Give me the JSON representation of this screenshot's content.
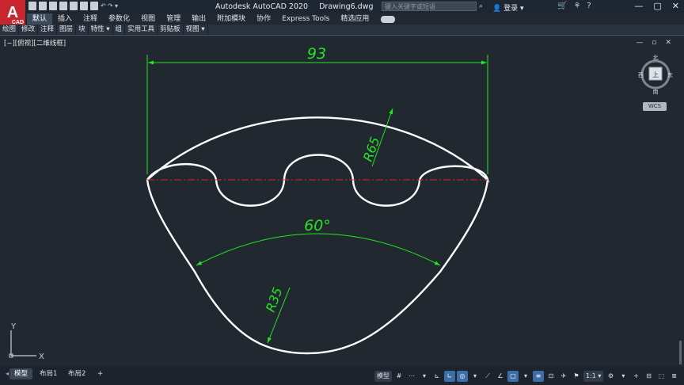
{
  "app": {
    "logo_letter": "A",
    "logo_badge": "CAD",
    "title": "Autodesk AutoCAD 2020",
    "document": "Drawing6.dwg",
    "search_placeholder": "键入关键字或短语",
    "login": "登录"
  },
  "menu": [
    "默认",
    "插入",
    "注释",
    "参数化",
    "视图",
    "管理",
    "输出",
    "附加模块",
    "协作",
    "Express Tools",
    "精选应用"
  ],
  "active_menu": "默认",
  "ribbon_panels": [
    "绘图",
    "修改",
    "注释",
    "图层",
    "块",
    "特性 ▾",
    "组",
    "实用工具",
    "剪贴板",
    "视图 ▾"
  ],
  "viewport_label": "[−][俯视][二维线框]",
  "view_cube": {
    "north": "北",
    "south": "南",
    "east": "东",
    "west": "西",
    "top": "上",
    "wcs": "WCS"
  },
  "ucs": {
    "x": "X",
    "y": "Y"
  },
  "drawing": {
    "dim_width": "93",
    "dim_radius_large": "R65",
    "dim_angle": "60°",
    "dim_radius_small": "R35",
    "colors": {
      "outline": "#ffffff",
      "dimension": "#22e622",
      "centerline": "#e8212b",
      "background": "#212830"
    }
  },
  "layout_tabs": [
    "模型",
    "布局1",
    "布局2"
  ],
  "add_tab": "+",
  "active_tab": "模型",
  "status": {
    "model_label": "模型",
    "scale_label": "1:1 ▾"
  }
}
